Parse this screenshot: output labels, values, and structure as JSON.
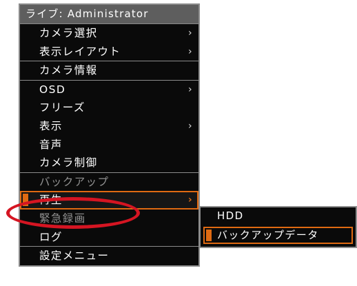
{
  "menu": {
    "title": "ライブ: Administrator",
    "items": [
      {
        "label": "カメラ選択",
        "chevron": "›"
      },
      {
        "label": "表示レイアウト",
        "chevron": "›"
      },
      {
        "label": "カメラ情報"
      },
      {
        "label": "OSD",
        "chevron": "›"
      },
      {
        "label": "フリーズ"
      },
      {
        "label": "表示",
        "chevron": "›"
      },
      {
        "label": "音声"
      },
      {
        "label": "カメラ制御"
      },
      {
        "label": "バックアップ"
      },
      {
        "label": "再生",
        "chevron": "›",
        "selected": true
      },
      {
        "label": "緊急録画"
      },
      {
        "label": "ログ"
      },
      {
        "label": "設定メニュー"
      }
    ]
  },
  "submenu": {
    "items": [
      {
        "label": "HDD"
      },
      {
        "label": "バックアップデータ",
        "selected": true
      }
    ]
  },
  "colors": {
    "accent": "#e06a12",
    "highlight_ring": "#d51522",
    "menu_background": "#0a0a0a",
    "title_background": "#5e5e5e",
    "border": "#8c8c8c"
  },
  "icons": {
    "submenu_chevron": "chevron-right-icon",
    "selection_marker": "selection-bar-icon"
  }
}
